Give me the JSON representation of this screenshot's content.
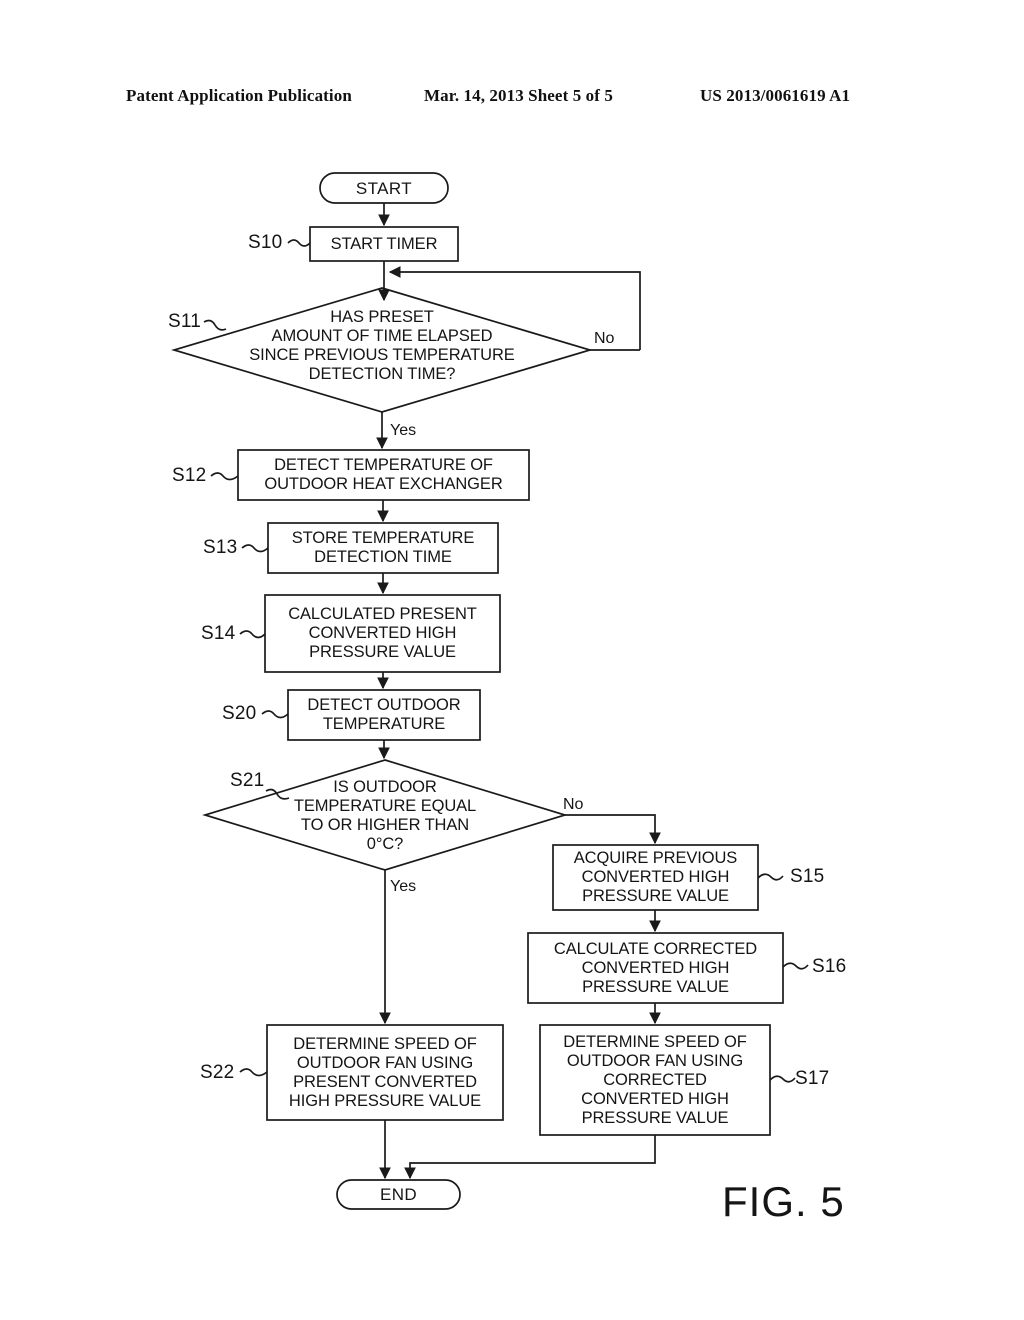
{
  "header": {
    "left": "Patent Application Publication",
    "middle": "Mar. 14, 2013  Sheet 5 of 5",
    "right": "US 2013/0061619 A1"
  },
  "figure": {
    "caption": "FIG. 5",
    "stroke_color": "#1a1a1a"
  },
  "nodes": {
    "start": {
      "label": "START",
      "shape": "terminator"
    },
    "s10": {
      "ref": "S10",
      "shape": "process",
      "lines": [
        "START TIMER"
      ]
    },
    "s11": {
      "ref": "S11",
      "shape": "decision",
      "lines": [
        "HAS PRESET",
        "AMOUNT OF TIME ELAPSED",
        "SINCE PREVIOUS TEMPERATURE",
        "DETECTION TIME?"
      ]
    },
    "s12": {
      "ref": "S12",
      "shape": "process",
      "lines": [
        "DETECT TEMPERATURE OF",
        "OUTDOOR HEAT EXCHANGER"
      ]
    },
    "s13": {
      "ref": "S13",
      "shape": "process",
      "lines": [
        "STORE TEMPERATURE",
        "DETECTION TIME"
      ]
    },
    "s14": {
      "ref": "S14",
      "shape": "process",
      "lines": [
        "CALCULATED PRESENT",
        "CONVERTED HIGH",
        "PRESSURE VALUE"
      ]
    },
    "s20": {
      "ref": "S20",
      "shape": "process",
      "lines": [
        "DETECT OUTDOOR",
        "TEMPERATURE"
      ]
    },
    "s21": {
      "ref": "S21",
      "shape": "decision",
      "lines": [
        "IS OUTDOOR",
        "TEMPERATURE EQUAL",
        "TO OR HIGHER THAN",
        "0°C?"
      ]
    },
    "s15": {
      "ref": "S15",
      "shape": "process",
      "lines": [
        "ACQUIRE PREVIOUS",
        "CONVERTED HIGH",
        "PRESSURE VALUE"
      ]
    },
    "s16": {
      "ref": "S16",
      "shape": "process",
      "lines": [
        "CALCULATE CORRECTED",
        "CONVERTED HIGH",
        "PRESSURE VALUE"
      ]
    },
    "s22": {
      "ref": "S22",
      "shape": "process",
      "lines": [
        "DETERMINE SPEED OF",
        "OUTDOOR FAN USING",
        "PRESENT CONVERTED",
        "HIGH PRESSURE VALUE"
      ]
    },
    "s17": {
      "ref": "S17",
      "shape": "process",
      "lines": [
        "DETERMINE SPEED OF",
        "OUTDOOR FAN USING",
        "CORRECTED",
        "CONVERTED HIGH",
        "PRESSURE VALUE"
      ]
    },
    "end": {
      "label": "END",
      "shape": "terminator"
    }
  },
  "branches": {
    "s11_no": "No",
    "s11_yes": "Yes",
    "s21_no": "No",
    "s21_yes": "Yes"
  }
}
